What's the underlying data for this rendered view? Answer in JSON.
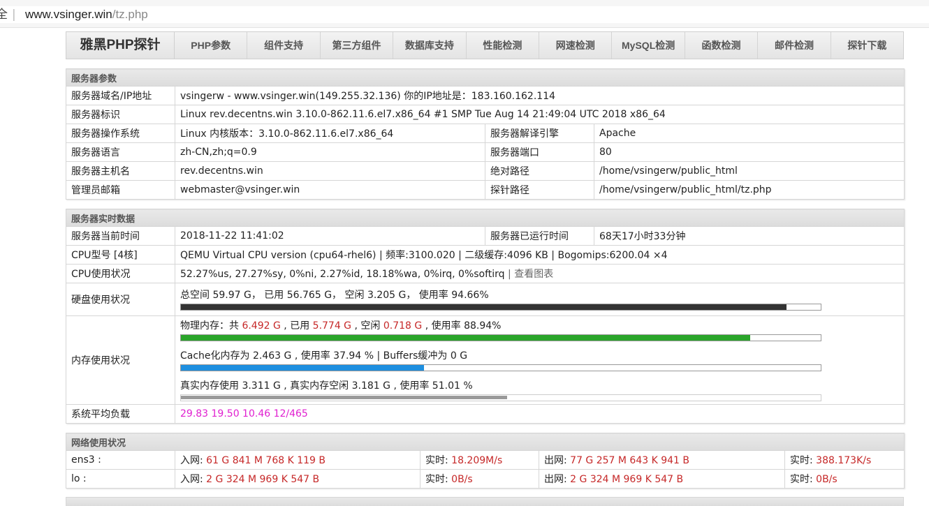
{
  "browser": {
    "security_label": "全",
    "separator": "|",
    "url_host": "www.vsinger.win",
    "url_path": "/tz.php"
  },
  "nav": {
    "brand": "雅黑PHP探针",
    "items": [
      "PHP参数",
      "组件支持",
      "第三方组件",
      "数据库支持",
      "性能检测",
      "网速检测",
      "MySQL检测",
      "函数检测",
      "邮件检测",
      "探针下载"
    ]
  },
  "server_params": {
    "title": "服务器参数",
    "domain_label": "服务器域名/IP地址",
    "domain_value": "vsingerw - www.vsinger.win(149.255.32.136)  你的IP地址是：183.160.162.114",
    "id_label": "服务器标识",
    "id_value": "Linux rev.decentns.win 3.10.0-862.11.6.el7.x86_64 #1 SMP Tue Aug 14 21:49:04 UTC 2018 x86_64",
    "os_label": "服务器操作系统",
    "os_value": "Linux  内核版本：3.10.0-862.11.6.el7.x86_64",
    "engine_label": "服务器解译引擎",
    "engine_value": "Apache",
    "lang_label": "服务器语言",
    "lang_value": "zh-CN,zh;q=0.9",
    "port_label": "服务器端口",
    "port_value": "80",
    "host_label": "服务器主机名",
    "host_value": "rev.decentns.win",
    "abspath_label": "绝对路径",
    "abspath_value": "/home/vsingerw/public_html",
    "email_label": "管理员邮箱",
    "email_value": "webmaster@vsinger.win",
    "probepath_label": "探针路径",
    "probepath_value": "/home/vsingerw/public_html/tz.php"
  },
  "realtime": {
    "title": "服务器实时数据",
    "time_label": "服务器当前时间",
    "time_value": "2018-11-22 11:41:02",
    "uptime_label": "服务器已运行时间",
    "uptime_value": "68天17小时33分钟",
    "cpu_model_label": "CPU型号 [4核]",
    "cpu_model_value": "QEMU Virtual CPU version (cpu64-rhel6) | 频率:3100.020 | 二级缓存:4096 KB | Bogomips:6200.04 ×4",
    "cpu_usage_label": "CPU使用状况",
    "cpu_usage_value": "52.27%us, 27.27%sy, 0%ni, 2.27%id, 18.18%wa, 0%irq, 0%softirq",
    "cpu_chart_link": "| 查看图表",
    "disk_label": "硬盘使用状况",
    "disk_total_prefix": "总空间 ",
    "disk_total": "59.97",
    "disk_used_prefix": " G，  已用 ",
    "disk_used": "56.765",
    "disk_free_prefix": " G，  空闲 ",
    "disk_free": "3.205",
    "disk_rate_prefix": " G，  使用率 ",
    "disk_rate": "94.66%",
    "disk_percent": 94.66,
    "disk_bar_color": "#333333",
    "mem_label": "内存使用状况",
    "mem_phys_prefix": "物理内存：共 ",
    "mem_total": "6.492 G",
    "mem_used_prefix": " , 已用 ",
    "mem_used": "5.774 G",
    "mem_free_prefix": " , 空闲 ",
    "mem_free": "0.718 G",
    "mem_rate_prefix": " , 使用率 ",
    "mem_rate": "88.94%",
    "mem_percent": 88.94,
    "mem_bar_color": "#2aa52a",
    "cache_text": "Cache化内存为 2.463 G , 使用率 37.94 % | Buffers缓冲为 0 G",
    "cache_percent": 37.94,
    "cache_bar_color": "#1e8fe0",
    "real_text": "真实内存使用 3.311 G , 真实内存空闲 3.181 G , 使用率 51.01 %",
    "real_percent": 51.01,
    "real_bar_color": "#9a9a9a",
    "load_label": "系统平均负载",
    "load_value": "29.83 19.50 10.46 12/465"
  },
  "network": {
    "title": "网络使用状况",
    "interfaces": [
      {
        "name": "ens3 :",
        "in_label": "入网: ",
        "in_value": "61 G 841 M 768 K 119 B",
        "in_rt_label": "实时: ",
        "in_rt_value": "18.209M/s",
        "out_label": "出网: ",
        "out_value": "77 G 257 M 643 K 941 B",
        "out_rt_label": "实时: ",
        "out_rt_value": "388.173K/s"
      },
      {
        "name": "lo :",
        "in_label": "入网: ",
        "in_value": "2 G 324 M 969 K 547 B",
        "in_rt_label": "实时: ",
        "in_rt_value": "0B/s",
        "out_label": "出网: ",
        "out_value": "2 G 324 M 969 K 547 B",
        "out_rt_label": "实时: ",
        "out_rt_value": "0B/s"
      }
    ]
  }
}
